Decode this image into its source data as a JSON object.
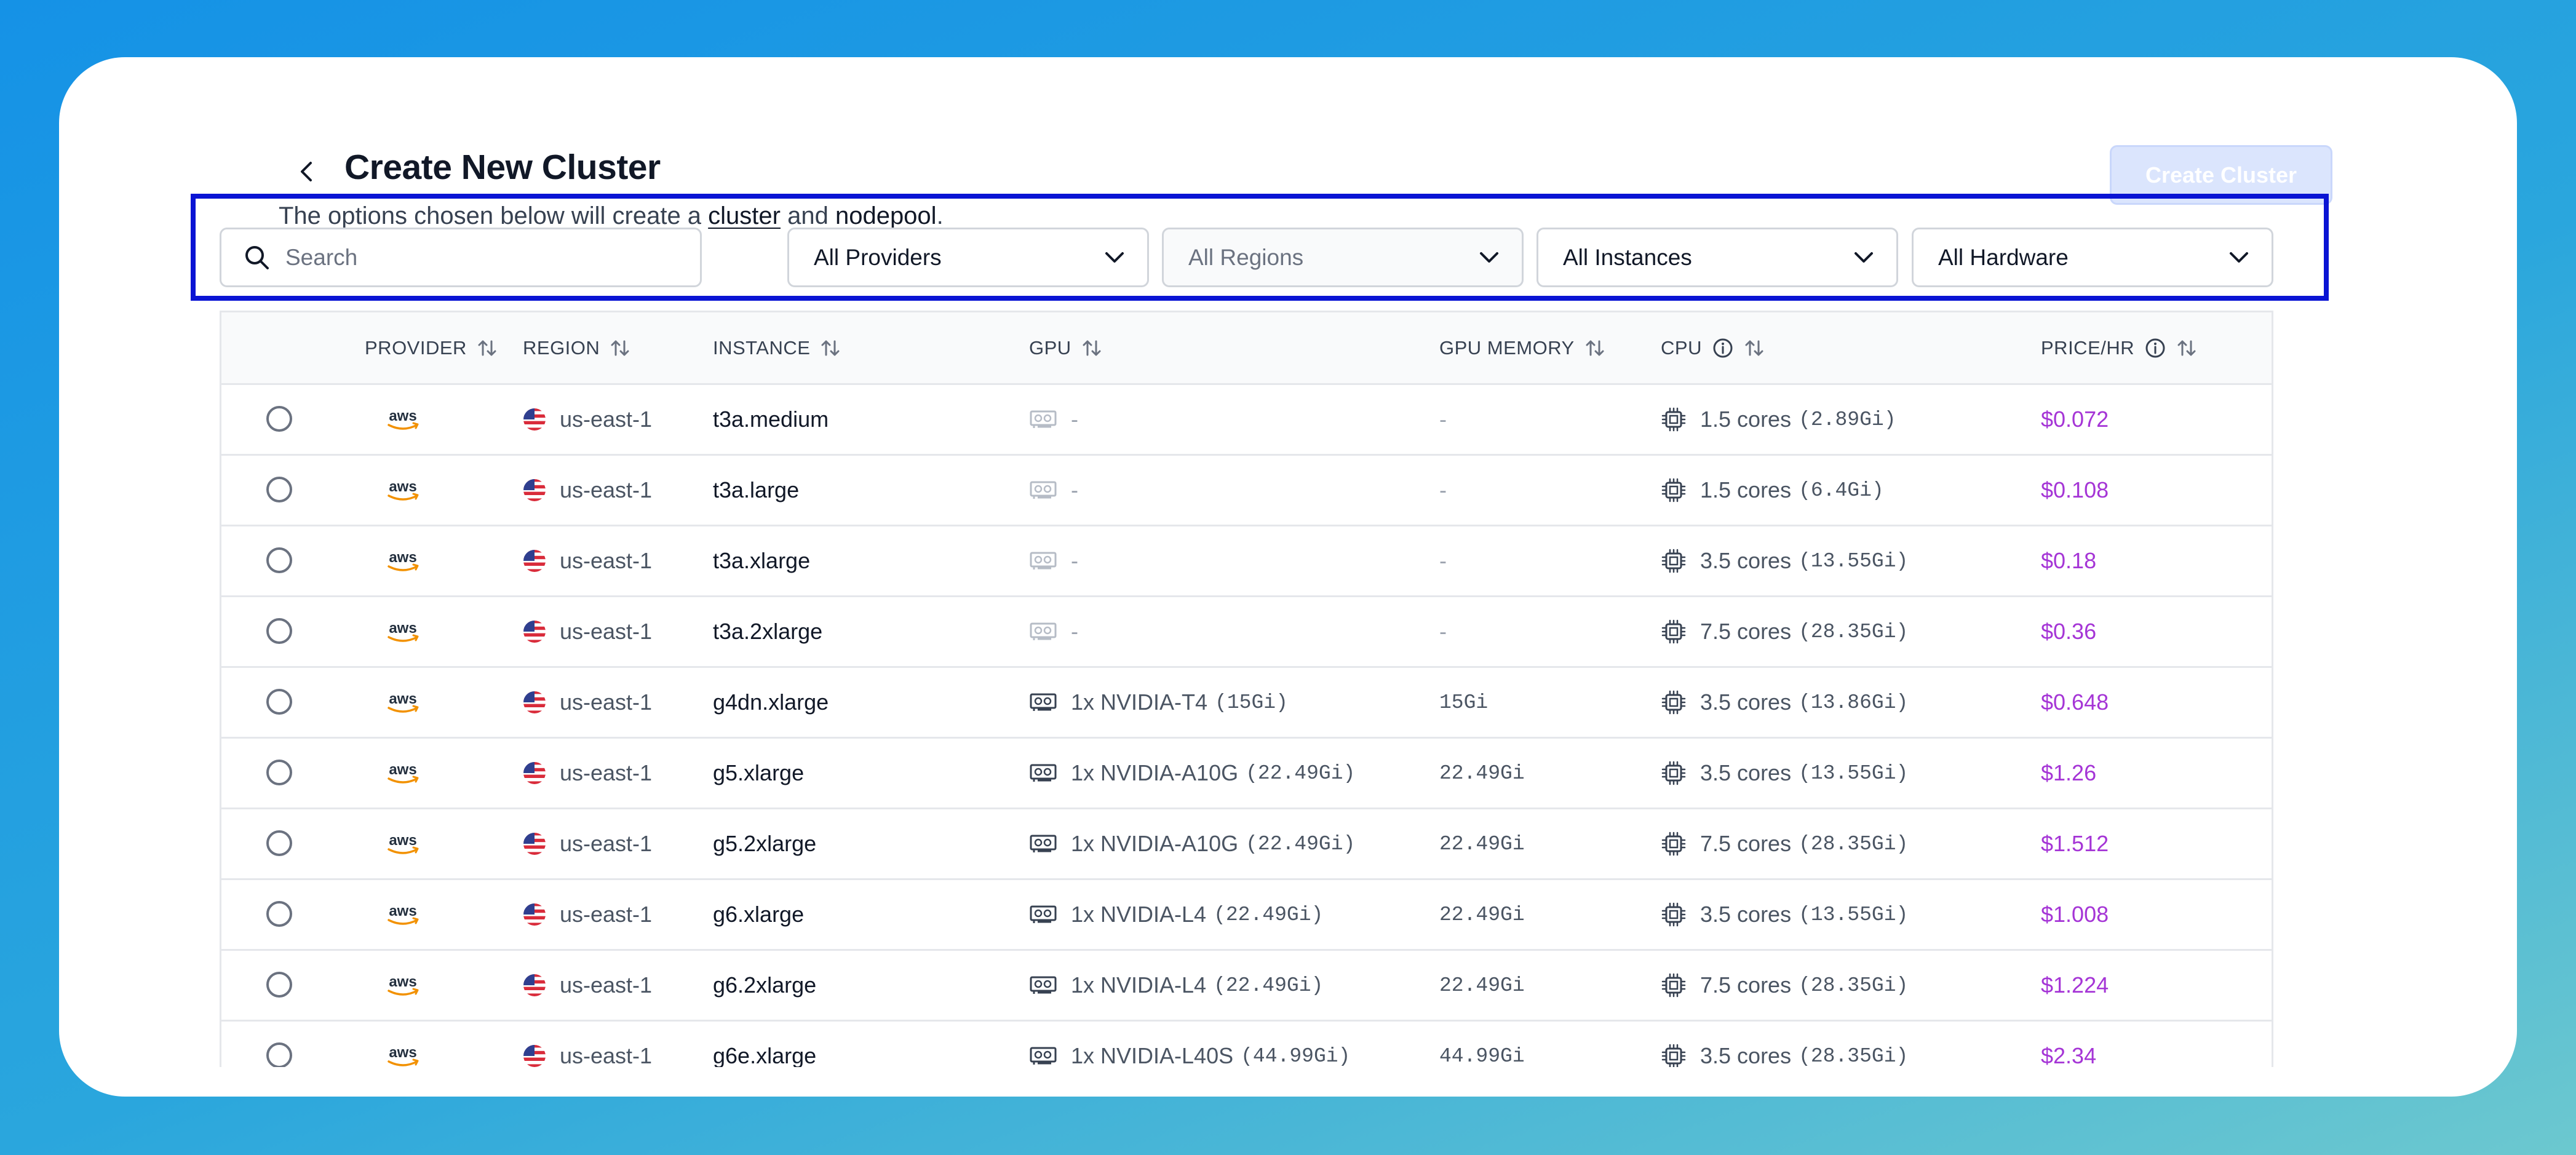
{
  "header": {
    "title": "Create New Cluster",
    "subtitle_prefix": "The options chosen below will create a ",
    "subtitle_link1": "cluster",
    "subtitle_mid": " and ",
    "subtitle_link2": "nodepool",
    "subtitle_suffix": ".",
    "create_button": "Create Cluster"
  },
  "filters": {
    "search_placeholder": "Search",
    "providers": "All Providers",
    "regions": "All Regions",
    "instances": "All Instances",
    "hardware": "All Hardware"
  },
  "columns": {
    "provider": "PROVIDER",
    "region": "REGION",
    "instance": "INSTANCE",
    "gpu": "GPU",
    "gpu_memory": "GPU MEMORY",
    "cpu": "CPU",
    "price": "PRICE/HR"
  },
  "icons": [
    "chevron-left-icon",
    "search-icon",
    "chevron-down-icon",
    "sort-icon",
    "info-icon",
    "aws-logo",
    "us-flag-icon",
    "gpu-card-icon",
    "cpu-chip-icon"
  ],
  "colors": {
    "price": "#a535d6",
    "button_disabled": "#dbe5fd",
    "highlight": "#0a14d4"
  },
  "rows": [
    {
      "region": "us-east-1",
      "instance": "t3a.medium",
      "gpu": "-",
      "gpu_mem_text": "",
      "gpu_memory": "-",
      "cpu": "1.5 cores",
      "cpu_mem": "(2.89Gi)",
      "price": "$0.072",
      "has_gpu": false
    },
    {
      "region": "us-east-1",
      "instance": "t3a.large",
      "gpu": "-",
      "gpu_mem_text": "",
      "gpu_memory": "-",
      "cpu": "1.5 cores",
      "cpu_mem": "(6.4Gi)",
      "price": "$0.108",
      "has_gpu": false
    },
    {
      "region": "us-east-1",
      "instance": "t3a.xlarge",
      "gpu": "-",
      "gpu_mem_text": "",
      "gpu_memory": "-",
      "cpu": "3.5 cores",
      "cpu_mem": "(13.55Gi)",
      "price": "$0.18",
      "has_gpu": false
    },
    {
      "region": "us-east-1",
      "instance": "t3a.2xlarge",
      "gpu": "-",
      "gpu_mem_text": "",
      "gpu_memory": "-",
      "cpu": "7.5 cores",
      "cpu_mem": "(28.35Gi)",
      "price": "$0.36",
      "has_gpu": false
    },
    {
      "region": "us-east-1",
      "instance": "g4dn.xlarge",
      "gpu": "1x NVIDIA-T4",
      "gpu_mem_text": "(15Gi)",
      "gpu_memory": "15Gi",
      "cpu": "3.5 cores",
      "cpu_mem": "(13.86Gi)",
      "price": "$0.648",
      "has_gpu": true
    },
    {
      "region": "us-east-1",
      "instance": "g5.xlarge",
      "gpu": "1x NVIDIA-A10G",
      "gpu_mem_text": "(22.49Gi)",
      "gpu_memory": "22.49Gi",
      "cpu": "3.5 cores",
      "cpu_mem": "(13.55Gi)",
      "price": "$1.26",
      "has_gpu": true
    },
    {
      "region": "us-east-1",
      "instance": "g5.2xlarge",
      "gpu": "1x NVIDIA-A10G",
      "gpu_mem_text": "(22.49Gi)",
      "gpu_memory": "22.49Gi",
      "cpu": "7.5 cores",
      "cpu_mem": "(28.35Gi)",
      "price": "$1.512",
      "has_gpu": true
    },
    {
      "region": "us-east-1",
      "instance": "g6.xlarge",
      "gpu": "1x NVIDIA-L4",
      "gpu_mem_text": "(22.49Gi)",
      "gpu_memory": "22.49Gi",
      "cpu": "3.5 cores",
      "cpu_mem": "(13.55Gi)",
      "price": "$1.008",
      "has_gpu": true
    },
    {
      "region": "us-east-1",
      "instance": "g6.2xlarge",
      "gpu": "1x NVIDIA-L4",
      "gpu_mem_text": "(22.49Gi)",
      "gpu_memory": "22.49Gi",
      "cpu": "7.5 cores",
      "cpu_mem": "(28.35Gi)",
      "price": "$1.224",
      "has_gpu": true
    },
    {
      "region": "us-east-1",
      "instance": "g6e.xlarge",
      "gpu": "1x NVIDIA-L40S",
      "gpu_mem_text": "(44.99Gi)",
      "gpu_memory": "44.99Gi",
      "cpu": "3.5 cores",
      "cpu_mem": "(28.35Gi)",
      "price": "$2.34",
      "has_gpu": true
    }
  ]
}
